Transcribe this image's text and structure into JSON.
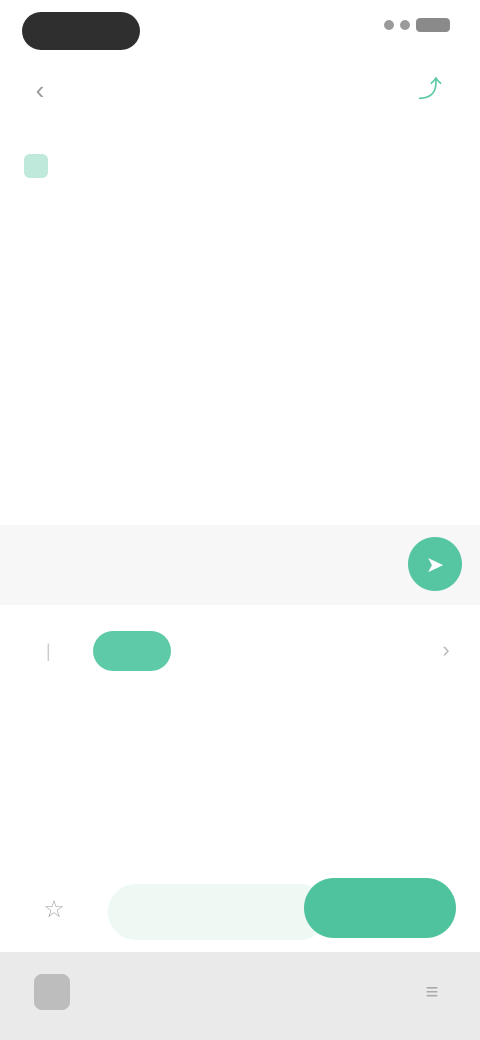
{
  "status_bar": {
    "time": "",
    "network": ""
  },
  "header": {
    "title": "",
    "back_icon": "chevron-left-icon",
    "action_icon": "share-icon"
  },
  "notice": {
    "icon": "info-icon",
    "text": ""
  },
  "input_row": {
    "placeholder": "",
    "send_icon": "send-icon"
  },
  "detail": {
    "label": "",
    "value": "",
    "tag": "",
    "more_icon": "chevron-right-icon",
    "caption": "",
    "description": ""
  },
  "action_bar": {
    "fav_icon": "star-icon",
    "hint": "",
    "primary_label": ""
  },
  "nav_bar": {
    "home_icon": "home-icon",
    "menu_icon": "menu-icon"
  },
  "colors": {
    "accent": "#4fc39e",
    "accent_light": "#eef9f4"
  }
}
